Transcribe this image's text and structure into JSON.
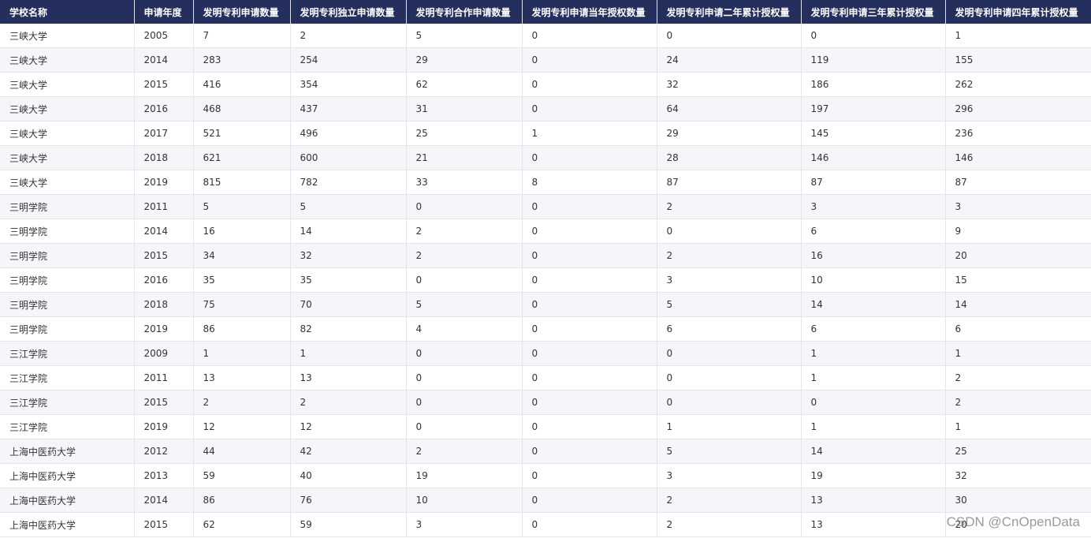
{
  "columns": [
    "学校名称",
    "申请年度",
    "发明专利申请数量",
    "发明专利独立申请数量",
    "发明专利合作申请数量",
    "发明专利申请当年授权数量",
    "发明专利申请二年累计授权量",
    "发明专利申请三年累计授权量",
    "发明专利申请四年累计授权量"
  ],
  "rows": [
    [
      "三峡大学",
      "2005",
      "7",
      "2",
      "5",
      "0",
      "0",
      "0",
      "1"
    ],
    [
      "三峡大学",
      "2014",
      "283",
      "254",
      "29",
      "0",
      "24",
      "119",
      "155"
    ],
    [
      "三峡大学",
      "2015",
      "416",
      "354",
      "62",
      "0",
      "32",
      "186",
      "262"
    ],
    [
      "三峡大学",
      "2016",
      "468",
      "437",
      "31",
      "0",
      "64",
      "197",
      "296"
    ],
    [
      "三峡大学",
      "2017",
      "521",
      "496",
      "25",
      "1",
      "29",
      "145",
      "236"
    ],
    [
      "三峡大学",
      "2018",
      "621",
      "600",
      "21",
      "0",
      "28",
      "146",
      "146"
    ],
    [
      "三峡大学",
      "2019",
      "815",
      "782",
      "33",
      "8",
      "87",
      "87",
      "87"
    ],
    [
      "三明学院",
      "2011",
      "5",
      "5",
      "0",
      "0",
      "2",
      "3",
      "3"
    ],
    [
      "三明学院",
      "2014",
      "16",
      "14",
      "2",
      "0",
      "0",
      "6",
      "9"
    ],
    [
      "三明学院",
      "2015",
      "34",
      "32",
      "2",
      "0",
      "2",
      "16",
      "20"
    ],
    [
      "三明学院",
      "2016",
      "35",
      "35",
      "0",
      "0",
      "3",
      "10",
      "15"
    ],
    [
      "三明学院",
      "2018",
      "75",
      "70",
      "5",
      "0",
      "5",
      "14",
      "14"
    ],
    [
      "三明学院",
      "2019",
      "86",
      "82",
      "4",
      "0",
      "6",
      "6",
      "6"
    ],
    [
      "三江学院",
      "2009",
      "1",
      "1",
      "0",
      "0",
      "0",
      "1",
      "1"
    ],
    [
      "三江学院",
      "2011",
      "13",
      "13",
      "0",
      "0",
      "0",
      "1",
      "2"
    ],
    [
      "三江学院",
      "2015",
      "2",
      "2",
      "0",
      "0",
      "0",
      "0",
      "2"
    ],
    [
      "三江学院",
      "2019",
      "12",
      "12",
      "0",
      "0",
      "1",
      "1",
      "1"
    ],
    [
      "上海中医药大学",
      "2012",
      "44",
      "42",
      "2",
      "0",
      "5",
      "14",
      "25"
    ],
    [
      "上海中医药大学",
      "2013",
      "59",
      "40",
      "19",
      "0",
      "3",
      "19",
      "32"
    ],
    [
      "上海中医药大学",
      "2014",
      "86",
      "76",
      "10",
      "0",
      "2",
      "13",
      "30"
    ],
    [
      "上海中医药大学",
      "2015",
      "62",
      "59",
      "3",
      "0",
      "2",
      "13",
      "20"
    ]
  ],
  "watermark": "CSDN @CnOpenData",
  "colors": {
    "header_bg": "#242f5e",
    "alt_row": "#f5f6f9"
  }
}
